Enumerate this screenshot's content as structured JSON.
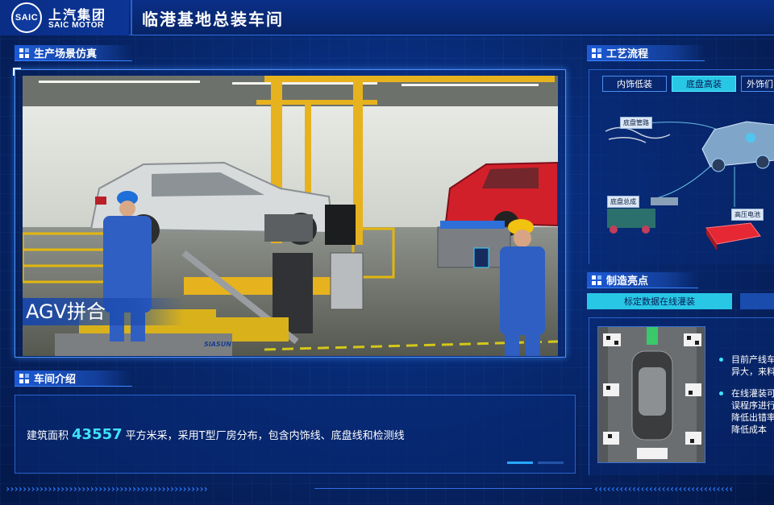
{
  "header": {
    "logo_mark": "SAIC",
    "logo_cn": "上汽集团",
    "logo_en": "SAIC MOTOR",
    "title": "临港基地总装车间"
  },
  "scene_section": {
    "title": "生产场景仿真",
    "caption": "AGV拼合",
    "agv_brand": "SIASUN"
  },
  "intro_section": {
    "title": "车间介绍",
    "text_prefix": "建筑面积",
    "area_value": "43557",
    "text_suffix": "平方米采，采用T型厂房分布，包含内饰线、底盘线和检测线"
  },
  "process_section": {
    "title": "工艺流程",
    "tabs": [
      {
        "label": "内饰低装",
        "active": false
      },
      {
        "label": "底盘高装",
        "active": true
      },
      {
        "label": "外饰们",
        "active": false
      }
    ],
    "parts": [
      "底盘管路",
      "底盘总成",
      "高压电池"
    ]
  },
  "highlights_section": {
    "title": "制造亮点",
    "tabs": [
      {
        "label": "标定数据在线灌装",
        "active": true
      },
      {
        "label": "",
        "active": false
      }
    ],
    "bullets": [
      "目前产线车\n异大，来料",
      "在线灌装可\n误程序进行\n降低出错率\n降低成本"
    ]
  },
  "colors": {
    "background": "#07205e",
    "accent": "#29c7e6",
    "highlight_number": "#3fe2ff",
    "border": "#2a63cc"
  }
}
